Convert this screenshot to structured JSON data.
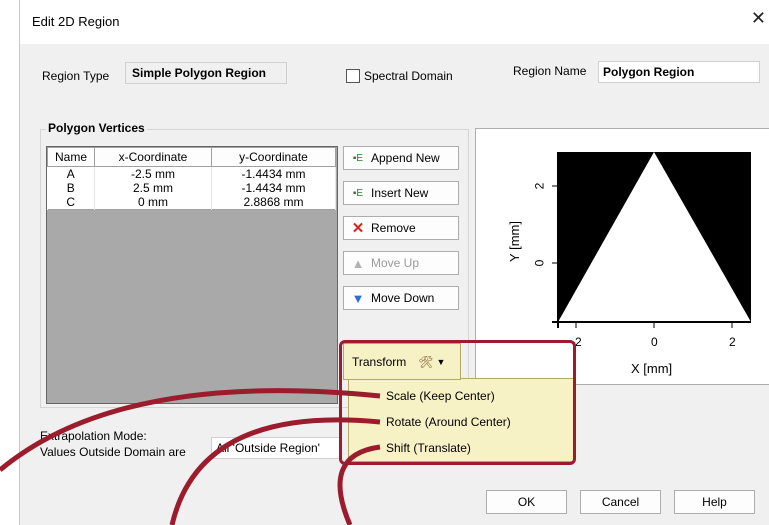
{
  "dialog": {
    "title": "Edit 2D Region"
  },
  "region_type": {
    "label": "Region Type",
    "value": "Simple Polygon Region"
  },
  "spectral_domain": {
    "label": "Spectral Domain",
    "checked": false
  },
  "region_name": {
    "label": "Region Name",
    "value": "Polygon Region"
  },
  "vertices": {
    "group_title": "Polygon Vertices",
    "columns": [
      "Name",
      "x-Coordinate",
      "y-Coordinate"
    ],
    "rows": [
      [
        "A",
        "-2.5 mm",
        "-1.4434 mm"
      ],
      [
        "B",
        "2.5 mm",
        "-1.4434 mm"
      ],
      [
        "C",
        "0 mm",
        "2.8868 mm"
      ]
    ]
  },
  "buttons": {
    "append": "Append New",
    "insert": "Insert New",
    "remove": "Remove",
    "move_up": "Move Up",
    "move_down": "Move Down",
    "transform": "Transform",
    "ok": "OK",
    "cancel": "Cancel",
    "help": "Help"
  },
  "transform_menu": [
    "Scale (Keep Center)",
    "Rotate (Around Center)",
    "Shift (Translate)"
  ],
  "extrapolation": {
    "label_line1": "Extrapolation Mode:",
    "label_line2": "Values Outside Domain are",
    "value": "All 'Outside Region'"
  },
  "plot": {
    "xlabel": "X [mm]",
    "ylabel": "Y [mm]",
    "xticks": [
      "-2",
      "0",
      "2"
    ],
    "yticks": [
      "2",
      "0"
    ]
  },
  "chart_data": {
    "type": "scatter",
    "xlabel": "X [mm]",
    "ylabel": "Y [mm]",
    "polygon": [
      [
        -2.5,
        -1.4434
      ],
      [
        2.5,
        -1.4434
      ],
      [
        0,
        2.8868
      ]
    ],
    "xlim": [
      -2.5,
      2.5
    ],
    "ylim": [
      -1.4434,
      2.8868
    ]
  },
  "colors": {
    "highlight": "#9b1c2c",
    "menu_bg": "#f7f1c6",
    "grid_bg": "#a9a9a9"
  }
}
